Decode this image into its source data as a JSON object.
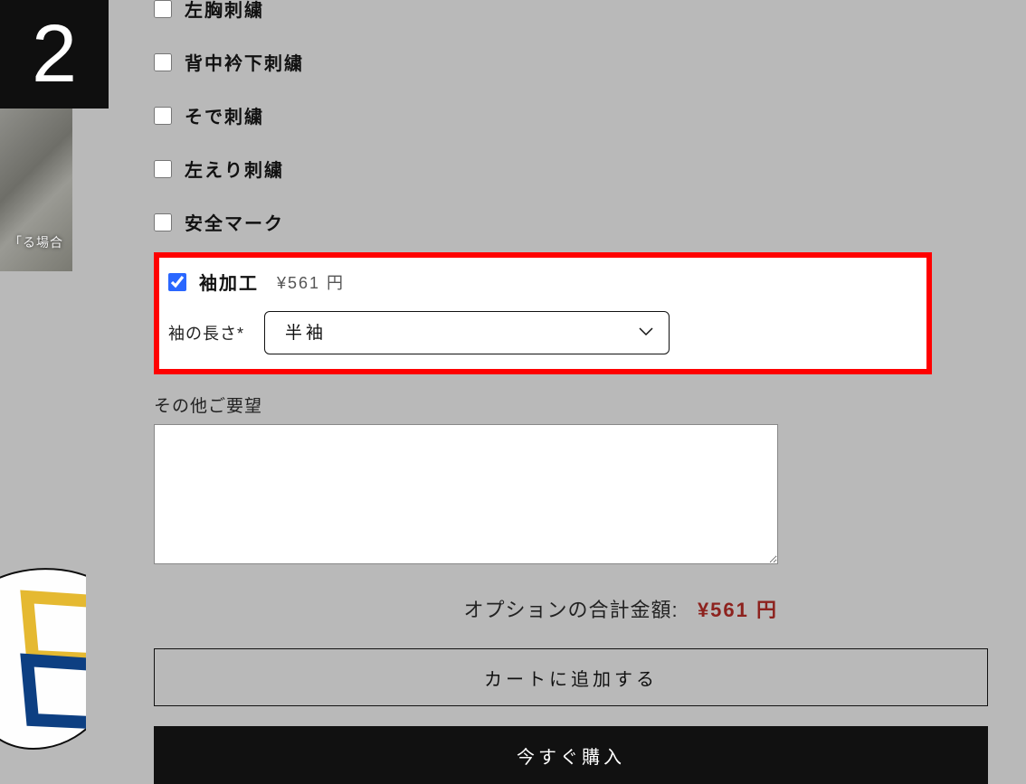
{
  "step_number": "2",
  "thumbnail_caption": "「る場合",
  "options": [
    {
      "label": "左胸刺繍",
      "checked": false
    },
    {
      "label": "背中衿下刺繍",
      "checked": false
    },
    {
      "label": "そで刺繍",
      "checked": false
    },
    {
      "label": "左えり刺繍",
      "checked": false
    },
    {
      "label": "安全マーク",
      "checked": false
    },
    {
      "label": "袖加工",
      "checked": true,
      "price": "¥561 円"
    }
  ],
  "sleeve": {
    "label": "袖の長さ*",
    "value": "半袖"
  },
  "notes_label": "その他ご要望",
  "notes_value": "",
  "total_label": "オプションの合計金額:",
  "total_value": "¥561 円",
  "buttons": {
    "add_to_cart": "カートに追加する",
    "buy_now": "今すぐ購入"
  }
}
